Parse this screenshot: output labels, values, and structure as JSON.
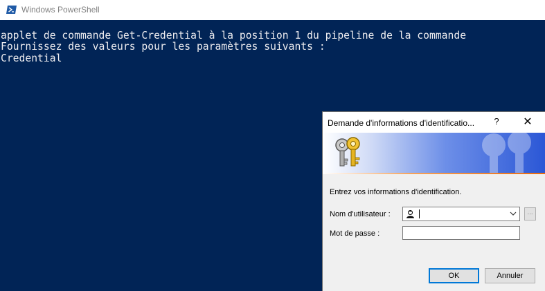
{
  "window": {
    "title": "Windows PowerShell",
    "icon": "powershell-icon"
  },
  "console": {
    "lines": [
      "applet de commande Get-Credential à la position 1 du pipeline de la commande",
      "Fournissez des valeurs pour les paramètres suivants :",
      "Credential"
    ]
  },
  "dialog": {
    "title": "Demande d'informations d'identificatio...",
    "help_label": "?",
    "close_label": "✕",
    "prompt": "Entrez vos informations d'identification.",
    "username_label": "Nom d'utilisateur :",
    "username_value": "",
    "password_label": "Mot de passe :",
    "password_value": "",
    "browse_label": "...",
    "ok_label": "OK",
    "cancel_label": "Annuler"
  },
  "colors": {
    "console_bg": "#012456",
    "console_text": "#eeedf0",
    "default_button_border": "#0078d7"
  }
}
